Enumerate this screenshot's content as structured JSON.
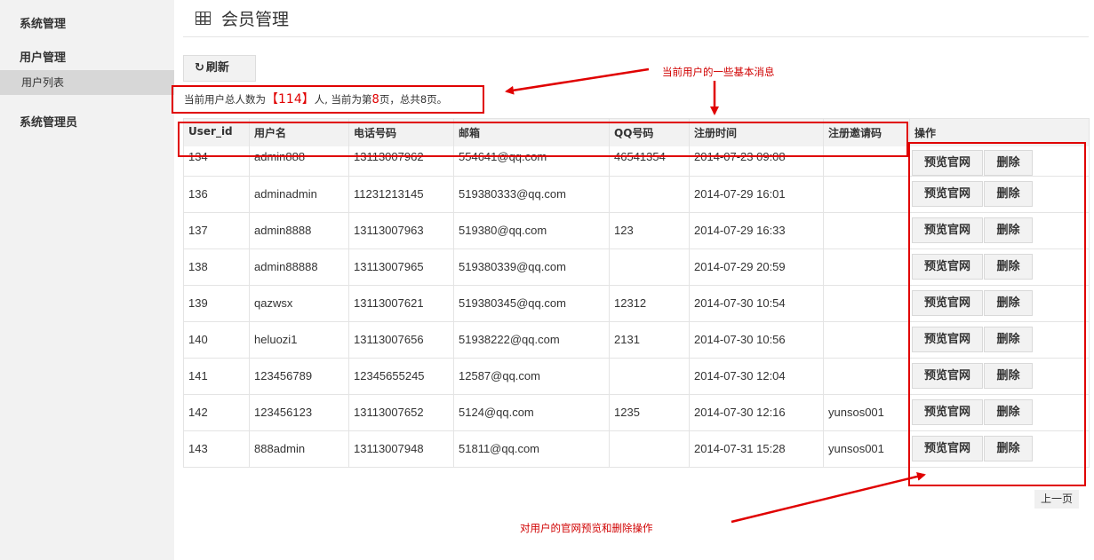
{
  "sidebar": {
    "sections": [
      "系统管理",
      "用户管理",
      "系统管理员"
    ],
    "active_item": "用户列表"
  },
  "header": {
    "title": "会员管理",
    "icon": "table-icon"
  },
  "toolbar": {
    "refresh_label": "刷新",
    "refresh_icon": "refresh-icon"
  },
  "summary": {
    "prefix": "当前用户总人数为",
    "total_users": "114",
    "middle": "人, 当前为第",
    "current_page": "8",
    "suffix": "页，总共8页。"
  },
  "table": {
    "columns": [
      "User_id",
      "用户名",
      "电话号码",
      "邮箱",
      "QQ号码",
      "注册时间",
      "注册邀请码",
      "操作"
    ],
    "preview_label": "预览官网",
    "delete_label": "删除",
    "rows": [
      {
        "id": "134",
        "username": "admin888",
        "phone": "13113007962",
        "email": "554641@qq.com",
        "qq": "46541354",
        "registered": "2014-07-23 09:08",
        "invite": ""
      },
      {
        "id": "136",
        "username": "adminadmin",
        "phone": "11231213145",
        "email": "519380333@qq.com",
        "qq": "",
        "registered": "2014-07-29 16:01",
        "invite": ""
      },
      {
        "id": "137",
        "username": "admin8888",
        "phone": "13113007963",
        "email": "519380@qq.com",
        "qq": "123",
        "registered": "2014-07-29 16:33",
        "invite": ""
      },
      {
        "id": "138",
        "username": "admin88888",
        "phone": "13113007965",
        "email": "519380339@qq.com",
        "qq": "",
        "registered": "2014-07-29 20:59",
        "invite": ""
      },
      {
        "id": "139",
        "username": "qazwsx",
        "phone": "13113007621",
        "email": "519380345@qq.com",
        "qq": "12312",
        "registered": "2014-07-30 10:54",
        "invite": ""
      },
      {
        "id": "140",
        "username": "heluozi1",
        "phone": "13113007656",
        "email": "51938222@qq.com",
        "qq": "2131",
        "registered": "2014-07-30 10:56",
        "invite": ""
      },
      {
        "id": "141",
        "username": "123456789",
        "phone": "12345655245",
        "email": "12587@qq.com",
        "qq": "",
        "registered": "2014-07-30 12:04",
        "invite": ""
      },
      {
        "id": "142",
        "username": "123456123",
        "phone": "13113007652",
        "email": "5124@qq.com",
        "qq": "1235",
        "registered": "2014-07-30 12:16",
        "invite": "yunsos001"
      },
      {
        "id": "143",
        "username": "888admin",
        "phone": "13113007948",
        "email": "51811@qq.com",
        "qq": "",
        "registered": "2014-07-31 15:28",
        "invite": "yunsos001"
      }
    ]
  },
  "pagination": {
    "prev_label": "上一页"
  },
  "annotations": {
    "top_note": "当前用户的一些基本消息",
    "bottom_note": "对用户的官网预览和删除操作",
    "color": "#e00000"
  }
}
